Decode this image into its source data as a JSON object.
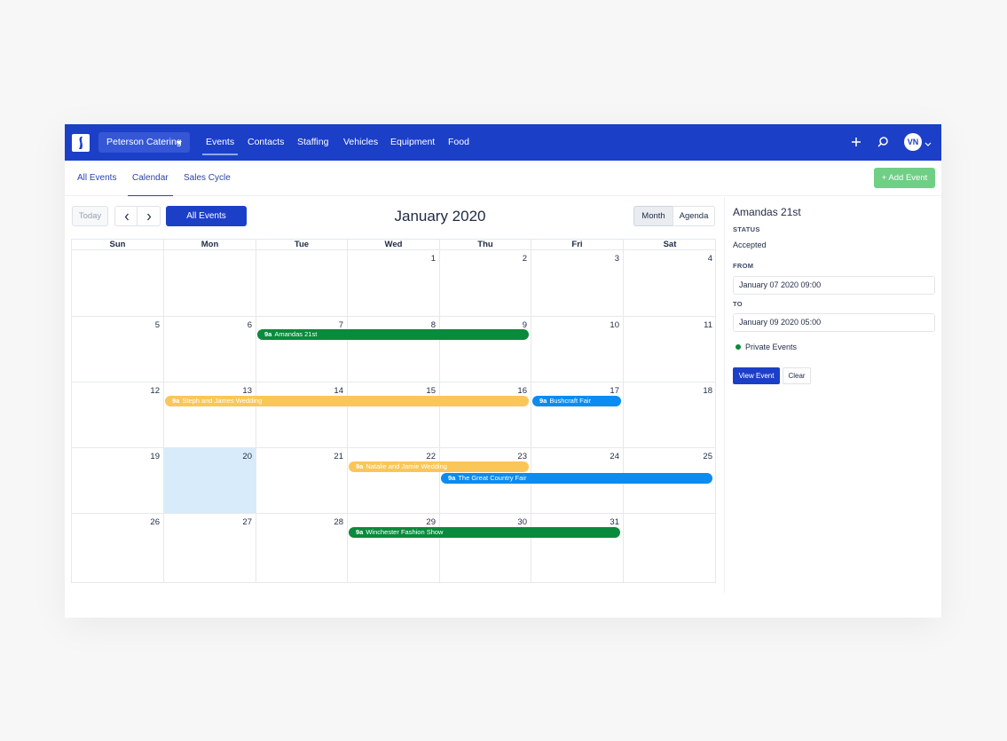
{
  "nav": {
    "org": "Peterson Catering",
    "items": [
      "Events",
      "Contacts",
      "Staffing",
      "Vehicles",
      "Equipment",
      "Food"
    ],
    "avatar": "VN"
  },
  "subnav": {
    "items": [
      "All Events",
      "Calendar",
      "Sales Cycle"
    ],
    "add_event": "+ Add Event"
  },
  "toolbar": {
    "today": "Today",
    "filter": "All Events",
    "title": "January 2020",
    "month": "Month",
    "agenda": "Agenda"
  },
  "calendar": {
    "weekdays": [
      "Sun",
      "Mon",
      "Tue",
      "Wed",
      "Thu",
      "Fri",
      "Sat"
    ],
    "weeks": [
      [
        "",
        "",
        "",
        "1",
        "2",
        "3",
        "4"
      ],
      [
        "5",
        "6",
        "7",
        "8",
        "9",
        "10",
        "11"
      ],
      [
        "12",
        "13",
        "14",
        "15",
        "16",
        "17",
        "18"
      ],
      [
        "19",
        "20",
        "21",
        "22",
        "23",
        "24",
        "25"
      ],
      [
        "26",
        "27",
        "28",
        "29",
        "30",
        "31",
        ""
      ]
    ],
    "events": [
      {
        "time": "9a",
        "title": "Amandas 21st",
        "color": "#0a8a3c"
      },
      {
        "time": "9a",
        "title": "Steph and James Wedding",
        "color": "#fbc658"
      },
      {
        "time": "9a",
        "title": "Bushcraft Fair",
        "color": "#0a8cf0"
      },
      {
        "time": "9a",
        "title": "Natalie and Jamie Wedding",
        "color": "#fbc658"
      },
      {
        "time": "9a",
        "title": "The Great Country Fair",
        "color": "#0a8cf0"
      },
      {
        "time": "9a",
        "title": "Winchester Fashion Show",
        "color": "#0a8a3c"
      }
    ]
  },
  "panel": {
    "title": "Amandas 21st",
    "status_label": "STATUS",
    "status": "Accepted",
    "from_label": "FROM",
    "from": "January 07 2020 09:00",
    "to_label": "TO",
    "to": "January 09 2020 05:00",
    "category": "Private Events",
    "view_button": "View Event",
    "clear_button": "Clear"
  },
  "colors": {
    "brand": "#1c3fc8",
    "success": "#6fcf85",
    "today_highlight": "#d8ebfb"
  }
}
